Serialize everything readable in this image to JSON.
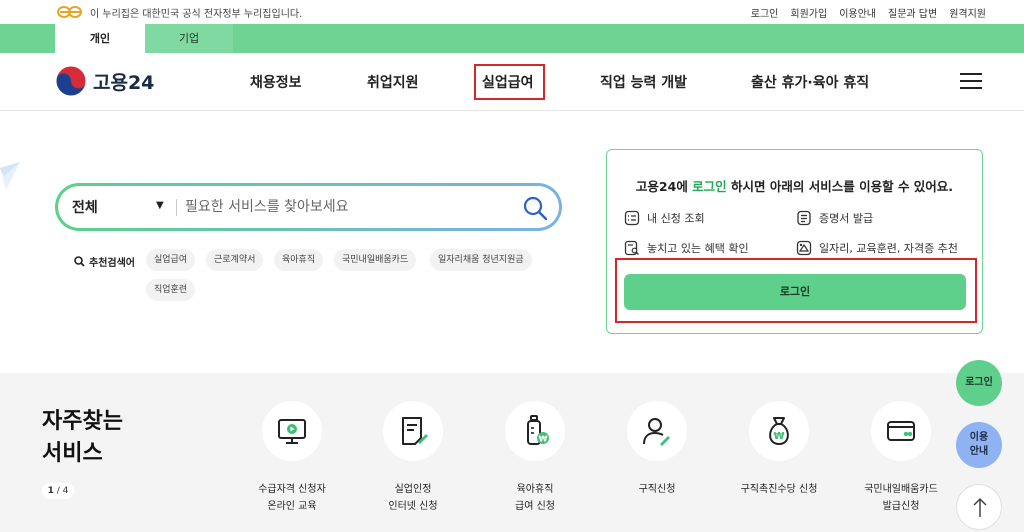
{
  "gov_banner": {
    "text": "이 누리집은 대한민국 공식 전자정부 누리집입니다.",
    "links": [
      "로그인",
      "회원가입",
      "이용안내",
      "질문과 답변",
      "원격지원"
    ]
  },
  "tabs": [
    "개인",
    "기업"
  ],
  "logo": {
    "text": "고용24"
  },
  "menu": [
    "채용정보",
    "취업지원",
    "실업급여",
    "직업 능력 개발",
    "출산 휴가·육아 휴직"
  ],
  "search": {
    "scope": "전체",
    "placeholder": "필요한 서비스를 찾아보세요"
  },
  "recommended": {
    "label": "추천검색어",
    "keywords": [
      "실업급여",
      "근로계약서",
      "육아휴직",
      "국민내일배움카드",
      "일자리채움 청년지원금",
      "직업훈련"
    ]
  },
  "login_card": {
    "title_pre": "고용24에 ",
    "title_accent": "로그인",
    "title_post": " 하시면 아래의 서비스를 이용할 수 있어요.",
    "services": [
      "내 신청 조회",
      "증명서 발급",
      "놓치고 있는 혜택 확인",
      "일자리, 교육훈련, 자격증 추천"
    ],
    "button": "로그인"
  },
  "favorites": {
    "title_line1": "자주찾는",
    "title_line2": "서비스",
    "pager_current": "1",
    "pager_sep": " / ",
    "pager_total": "4",
    "items": [
      {
        "icon": "monitor-play-icon",
        "label": "수급자격 신청자\n온라인 교육"
      },
      {
        "icon": "document-edit-icon",
        "label": "실업인정\n인터넷 신청"
      },
      {
        "icon": "baby-bottle-icon",
        "label": "육아휴직\n급여 신청"
      },
      {
        "icon": "person-edit-icon",
        "label": "구직신청"
      },
      {
        "icon": "money-bag-icon",
        "label": "구직촉진수당 신청"
      },
      {
        "icon": "card-icon",
        "label": "국민내일배움카드\n발급신청"
      }
    ]
  },
  "floating": {
    "login": "로그인",
    "guide_line1": "이용",
    "guide_line2": "안내"
  },
  "colors": {
    "brand_green": "#5fd08b",
    "highlight_red": "#d8252b",
    "accent_text": "#23a85a"
  }
}
